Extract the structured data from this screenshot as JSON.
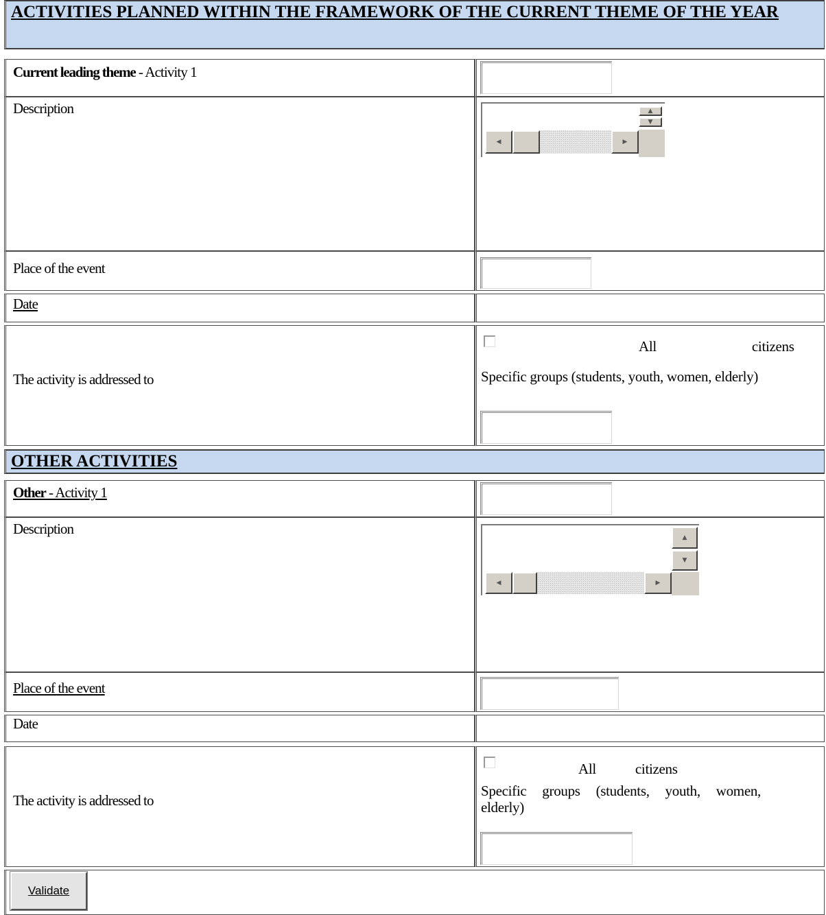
{
  "section1": {
    "title": "ACTIVITIES PLANNED WITHIN THE FRAMEWORK OF THE CURRENT THEME OF THE YEAR",
    "activity_label_bold": "Current leading theme",
    "activity_label_rest": " - Activity 1",
    "activity_value": "",
    "description_label": "Description",
    "description_value": "",
    "place_label": "Place of the event",
    "place_value": "",
    "date_label": "Date",
    "date_value": "",
    "addressed_label": "The activity is addressed to",
    "option_all": "All citizens",
    "option_all_checked": false,
    "option_specific": "Specific groups (students, youth, women, elderly)",
    "specific_value": ""
  },
  "section2": {
    "title": "OTHER ACTIVITIES",
    "activity_label_bold": "Other",
    "activity_label_rest": " - Activity 1",
    "activity_value": "",
    "description_label": "Description",
    "description_value": "",
    "place_label": "Place of the event",
    "place_value": "",
    "date_label": "Date",
    "date_value": "",
    "addressed_label": "The activity is addressed to",
    "option_all": "All citizens",
    "option_all_checked": false,
    "option_specific": "Specific groups (students, youth, women, elderly)",
    "specific_value": ""
  },
  "validate_label": "Validate",
  "colors": {
    "header_bg": "#c5d8ef",
    "border": "#4a4a4a",
    "button_bg": "#e4e4e4"
  },
  "icons": {
    "scroll_left": "scroll-left-icon",
    "scroll_right": "scroll-right-icon",
    "scroll_up": "scroll-up-icon",
    "scroll_down": "scroll-down-icon"
  }
}
